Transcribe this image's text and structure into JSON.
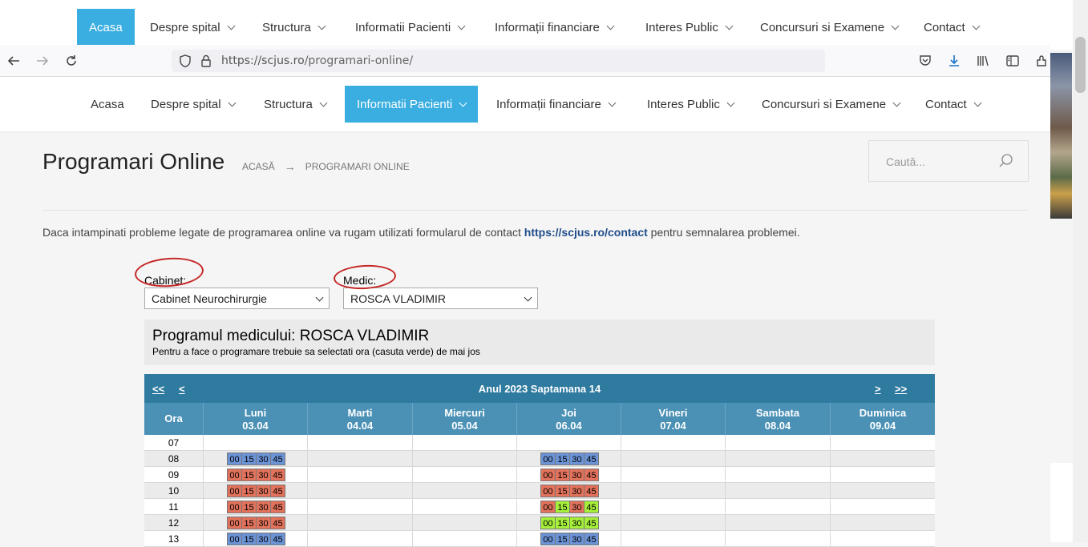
{
  "ghost_nav": {
    "items": [
      {
        "label": "Acasa",
        "dropdown": false,
        "active": true
      },
      {
        "label": "Despre spital",
        "dropdown": true
      },
      {
        "label": "Structura",
        "dropdown": true
      },
      {
        "label": "Informatii Pacienti",
        "dropdown": true
      },
      {
        "label": "Informații financiare",
        "dropdown": true
      },
      {
        "label": "Interes Public",
        "dropdown": true
      },
      {
        "label": "Concursuri si Examene",
        "dropdown": true
      },
      {
        "label": "Contact",
        "dropdown": true
      }
    ]
  },
  "browser": {
    "url_host": "https://scjus.ro",
    "url_path": "/programari-online/"
  },
  "main_nav": {
    "items": [
      {
        "label": "Acasa",
        "dropdown": false
      },
      {
        "label": "Despre spital",
        "dropdown": true
      },
      {
        "label": "Structura",
        "dropdown": true
      },
      {
        "label": "Informatii Pacienti",
        "dropdown": true,
        "active": true
      },
      {
        "label": "Informații financiare",
        "dropdown": true
      },
      {
        "label": "Interes Public",
        "dropdown": true
      },
      {
        "label": "Concursuri si Examene",
        "dropdown": true
      },
      {
        "label": "Contact",
        "dropdown": true
      }
    ]
  },
  "page": {
    "title": "Programari Online",
    "breadcrumb_home": "ACASĂ",
    "breadcrumb_current": "PROGRAMARI ONLINE",
    "search_placeholder": "Caută...",
    "notice_before": "Daca intampinati probleme legate de programarea online va rugam utilizati formularul de contact ",
    "notice_link": "https://scjus.ro/contact",
    "notice_after": " pentru semnalarea problemei."
  },
  "form": {
    "cabinet_label": "Cabinet:",
    "cabinet_value": "Cabinet Neurochirurgie",
    "medic_label": "Medic:",
    "medic_value": "ROSCA VLADIMIR"
  },
  "program": {
    "title": "Programul medicului: ROSCA VLADIMIR",
    "subtitle": "Pentru a face o programare trebuie sa selectati ora (casuta verde) de mai jos"
  },
  "calendar": {
    "nav_first": "<<",
    "nav_prev": "<",
    "nav_next": ">",
    "nav_last": ">>",
    "week_title": "Anul 2023 Saptamana 14",
    "hour_header": "Ora",
    "days": [
      {
        "name": "Luni",
        "date": "03.04"
      },
      {
        "name": "Marti",
        "date": "04.04"
      },
      {
        "name": "Miercuri",
        "date": "05.04"
      },
      {
        "name": "Joi",
        "date": "06.04"
      },
      {
        "name": "Vineri",
        "date": "07.04"
      },
      {
        "name": "Sambata",
        "date": "08.04"
      },
      {
        "name": "Duminica",
        "date": "09.04"
      }
    ],
    "slot_minutes": [
      "00",
      "15",
      "30",
      "45"
    ],
    "rows": [
      {
        "hour": "07",
        "luni": null,
        "joi": null
      },
      {
        "hour": "08",
        "luni": [
          "blue",
          "blue",
          "blue",
          "blue"
        ],
        "joi": [
          "blue",
          "blue",
          "blue",
          "blue"
        ]
      },
      {
        "hour": "09",
        "luni": [
          "red",
          "red",
          "red",
          "red"
        ],
        "joi": [
          "red",
          "red",
          "red",
          "red"
        ]
      },
      {
        "hour": "10",
        "luni": [
          "red",
          "red",
          "red",
          "red"
        ],
        "joi": [
          "red",
          "red",
          "red",
          "red"
        ]
      },
      {
        "hour": "11",
        "luni": [
          "red",
          "red",
          "red",
          "red"
        ],
        "joi": [
          "red",
          "green",
          "red",
          "green"
        ]
      },
      {
        "hour": "12",
        "luni": [
          "red",
          "red",
          "red",
          "red"
        ],
        "joi": [
          "green",
          "green",
          "green",
          "green"
        ]
      },
      {
        "hour": "13",
        "luni": [
          "blue",
          "blue",
          "blue",
          "blue"
        ],
        "joi": [
          "blue",
          "blue",
          "blue",
          "blue"
        ]
      }
    ]
  },
  "colors": {
    "accent": "#3aaee0",
    "cal_header": "#2f7a9f",
    "cal_days": "#4b91b5",
    "slot_blue": "#6b93d6",
    "slot_red": "#e2725b",
    "slot_green": "#a6f03a",
    "annotation": "#c62828"
  }
}
